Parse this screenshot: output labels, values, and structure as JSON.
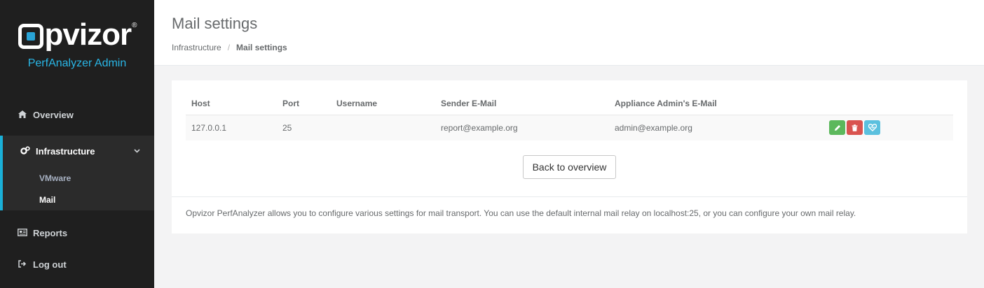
{
  "brand": {
    "name": "pvizor",
    "registered": "®",
    "subtitle": "PerfAnalyzer Admin"
  },
  "sidebar": {
    "overview": {
      "label": "Overview",
      "icon": "home-icon"
    },
    "infrastructure": {
      "label": "Infrastructure",
      "icon": "cogs-icon",
      "expanded": true,
      "children": [
        {
          "label": "VMware"
        },
        {
          "label": "Mail",
          "active": true
        }
      ]
    },
    "reports": {
      "label": "Reports",
      "icon": "newspaper-icon"
    },
    "logout": {
      "label": "Log out",
      "icon": "sign-out-icon"
    }
  },
  "header": {
    "title": "Mail settings",
    "breadcrumb": [
      "Infrastructure",
      "Mail settings"
    ]
  },
  "table": {
    "columns": [
      "Host",
      "Port",
      "Username",
      "Sender E-Mail",
      "Appliance Admin's E-Mail"
    ],
    "rows": [
      {
        "host": "127.0.0.1",
        "port": "25",
        "username": "",
        "sender": "report@example.org",
        "admin": "admin@example.org"
      }
    ]
  },
  "actions": {
    "back_label": "Back to overview"
  },
  "info_text": "Opvizor PerfAnalyzer allows you to configure various settings for mail transport. You can use the default internal mail relay on localhost:25, or you can configure your own mail relay.",
  "colors": {
    "sidebar_bg": "#1f1f1f",
    "accent": "#1ab0d8",
    "edit": "#5cb85c",
    "delete": "#d9534f",
    "info": "#5bc0de"
  }
}
